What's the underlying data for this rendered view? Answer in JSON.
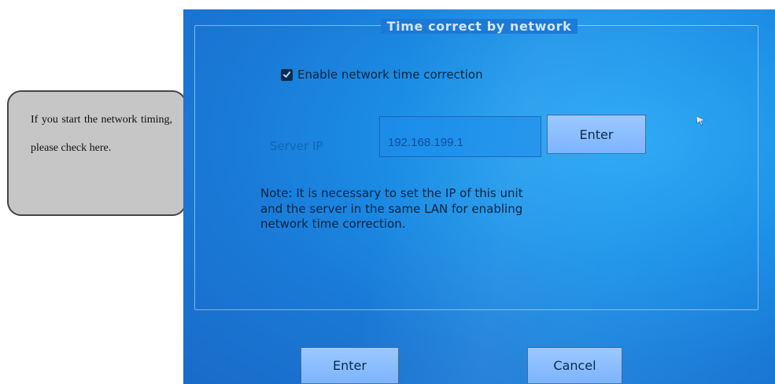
{
  "callout": {
    "text": "If you start the network timing, please check here."
  },
  "dialog": {
    "title": "Time correct by network",
    "enable_checkbox": {
      "label": "Enable network time correction",
      "checked": true
    },
    "server_ip": {
      "label": "Server IP",
      "value": "192.168.199.1"
    },
    "ip_enter_button": "Enter",
    "note": "Note: It is necessary to set the IP of this unit and the server in the same LAN for enabling network time correction.",
    "buttons": {
      "enter": "Enter",
      "cancel": "Cancel"
    }
  },
  "icons": {
    "checkbox_check": "check-icon",
    "cursor": "mouse-pointer-icon"
  },
  "colors": {
    "screen_blue": "#1b8fe6",
    "callout_gray": "#c6c6c6",
    "button_fill": "#8bbcff"
  }
}
